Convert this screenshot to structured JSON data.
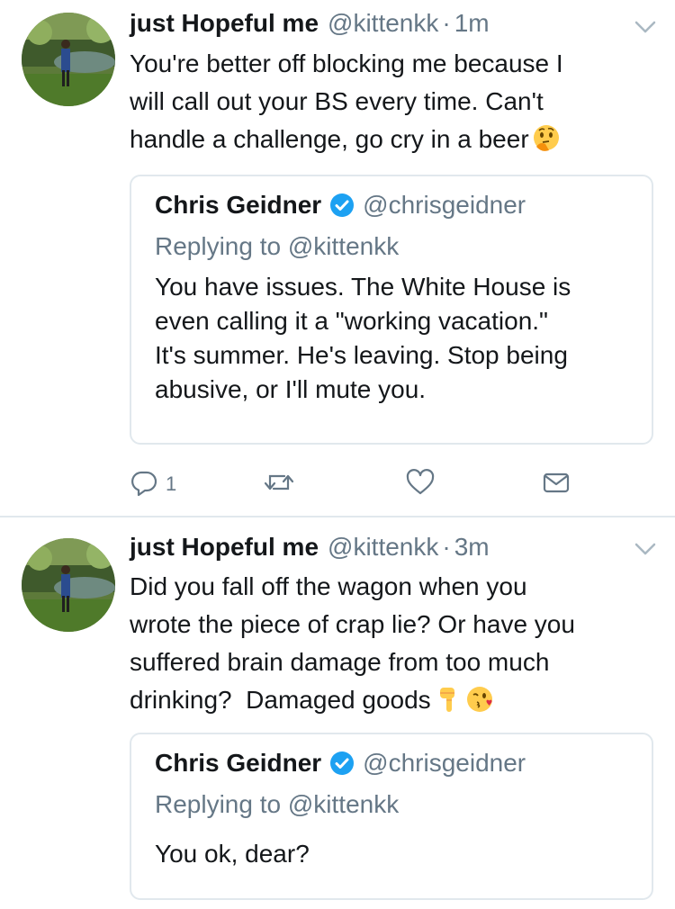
{
  "tweets": [
    {
      "author_name": "just Hopeful me",
      "author_handle": "@kittenkk",
      "separator": "·",
      "time": "1m",
      "text_lines": [
        "You're better off blocking me because I",
        "will call out your BS every time. Can't",
        "handle a challenge, go cry in a beer"
      ],
      "emojis": [
        "thinking-face"
      ],
      "quote": {
        "name": "Chris Geidner",
        "handle": "@chrisgeidner",
        "replying_to": "Replying to @kittenkk",
        "text_lines": [
          "You have issues. The White House is",
          "even calling it a \"working vacation.\"",
          "It's summer. He's leaving. Stop being",
          "abusive, or I'll mute you."
        ]
      },
      "actions": {
        "reply_count": "1"
      }
    },
    {
      "author_name": "just Hopeful me",
      "author_handle": "@kittenkk",
      "separator": "·",
      "time": "3m",
      "text_lines": [
        "Did you fall off the wagon when you",
        "wrote the piece of crap lie? Or have you",
        "suffered brain damage from too much",
        "drinking?  Damaged goods"
      ],
      "emojis": [
        "backhand-index-pointing-down",
        "face-blowing-kiss"
      ],
      "quote": {
        "name": "Chris Geidner",
        "handle": "@chrisgeidner",
        "replying_to": "Replying to @kittenkk",
        "text_lines": [
          "You ok, dear?"
        ]
      }
    }
  ],
  "colors": {
    "text": "#14171a",
    "secondary": "#657786",
    "border": "#e1e8ed",
    "verified": "#1da1f2"
  }
}
